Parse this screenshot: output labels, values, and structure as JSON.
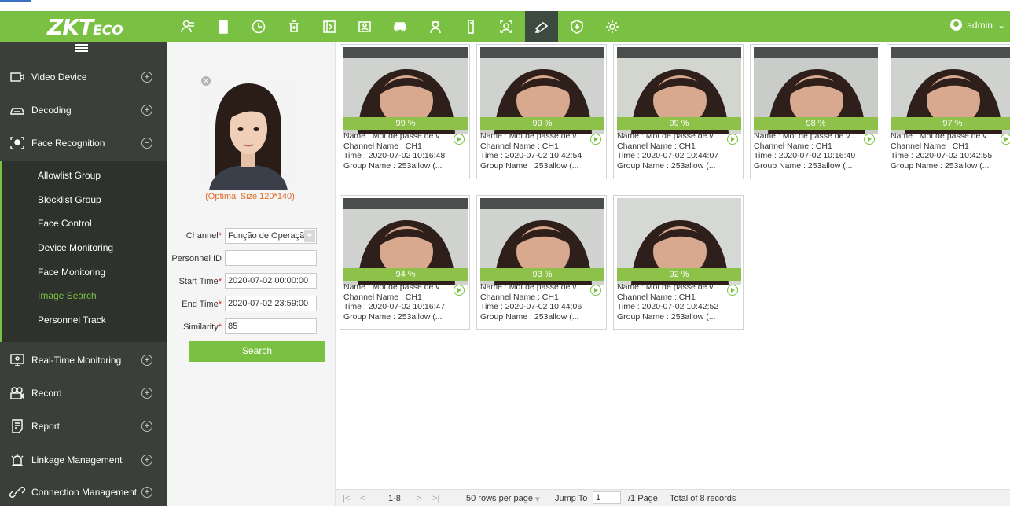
{
  "app": {
    "logo_main": "ZKT",
    "logo_small": "ECO",
    "user": "admin",
    "user_caret": "⌄"
  },
  "modules": [
    {
      "icon": "personnel-icon"
    },
    {
      "icon": "door-icon"
    },
    {
      "icon": "clock-icon"
    },
    {
      "icon": "elevator-icon"
    },
    {
      "icon": "hotel-icon"
    },
    {
      "icon": "reception-icon"
    },
    {
      "icon": "car-icon"
    },
    {
      "icon": "guard-icon"
    },
    {
      "icon": "device-icon"
    },
    {
      "icon": "face-scan-icon"
    },
    {
      "icon": "camera-icon",
      "active": true
    },
    {
      "icon": "shield-plus-icon"
    },
    {
      "icon": "settings-icon"
    }
  ],
  "sidebar": {
    "items": [
      {
        "label": "Video Device",
        "icon": "video-device-icon",
        "state": "+"
      },
      {
        "label": "Decoding",
        "icon": "decoding-icon",
        "state": "+"
      },
      {
        "label": "Face Recognition",
        "icon": "face-recognition-icon",
        "state": "−"
      },
      {
        "label": "Real-Time Monitoring",
        "icon": "monitor-icon",
        "state": "+"
      },
      {
        "label": "Record",
        "icon": "record-icon",
        "state": "+"
      },
      {
        "label": "Report",
        "icon": "report-icon",
        "state": "+"
      },
      {
        "label": "Linkage Management",
        "icon": "linkage-icon",
        "state": "+"
      },
      {
        "label": "Connection Management",
        "icon": "connection-icon",
        "state": "+"
      }
    ],
    "submenu": [
      "Allowlist Group",
      "Blocklist Group",
      "Face Control",
      "Device Monitoring",
      "Face Monitoring",
      "Image Search",
      "Personnel Track"
    ],
    "active_submenu": "Image Search"
  },
  "form": {
    "optimal_size": "(Optimal Size 120*140).",
    "channel_label": "Channel",
    "channel_value": "Função de Operação",
    "personnel_label": "Personnel ID",
    "personnel_value": "",
    "start_label": "Start Time",
    "start_value": "2020-07-02 00:00:00",
    "end_label": "End Time",
    "end_value": "2020-07-02 23:59:00",
    "similarity_label": "Similarity",
    "similarity_value": "85",
    "search_label": "Search",
    "required_mark": "*"
  },
  "results": [
    {
      "sim": "99 %",
      "name": "Name : Mot de passe de v...",
      "channel": "Channel Name : CH1",
      "time": "Time : 2020-07-02 10:16:48",
      "group": "Group Name :  253allow (..."
    },
    {
      "sim": "99 %",
      "name": "Name : Mot de passe de v...",
      "channel": "Channel Name : CH1",
      "time": "Time : 2020-07-02 10:42:54",
      "group": "Group Name :  253allow (..."
    },
    {
      "sim": "99 %",
      "name": "Name : Mot de passe de v...",
      "channel": "Channel Name : CH1",
      "time": "Time : 2020-07-02 10:44:07",
      "group": "Group Name :  253allow (..."
    },
    {
      "sim": "98 %",
      "name": "Name : Mot de passe de v...",
      "channel": "Channel Name : CH1",
      "time": "Time : 2020-07-02 10:16:49",
      "group": "Group Name :  253allow (..."
    },
    {
      "sim": "97 %",
      "name": "Name : Mot de passe de v...",
      "channel": "Channel Name : CH1",
      "time": "Time : 2020-07-02 10:42:55",
      "group": "Group Name :  253allow (..."
    },
    {
      "sim": "94 %",
      "name": "Name : Mot de passe de v...",
      "channel": "Channel Name : CH1",
      "time": "Time : 2020-07-02 10:16:47",
      "group": "Group Name :  253allow (..."
    },
    {
      "sim": "93 %",
      "name": "Name : Mot de passe de v...",
      "channel": "Channel Name : CH1",
      "time": "Time : 2020-07-02 10:44:06",
      "group": "Group Name :  253allow (..."
    },
    {
      "sim": "92 %",
      "name": "Name : Mot de passe de v...",
      "channel": "Channel Name : CH1",
      "time": "Time : 2020-07-02 10:42:52",
      "group": "Group Name :  253allow (..."
    }
  ],
  "pager": {
    "first": "|<",
    "prev": "<",
    "range": "1-8",
    "next": ">",
    "last": ">|",
    "rows_per_page": "50 rows per page",
    "rows_caret": "▾",
    "jump_label": "Jump To",
    "jump_value": "1",
    "page_of": "/1 Page",
    "total": "Total of 8 records"
  },
  "colors": {
    "accent": "#7ac143",
    "sidebar": "#3a3f3a",
    "optimal_size_text": "#e06b2a"
  }
}
